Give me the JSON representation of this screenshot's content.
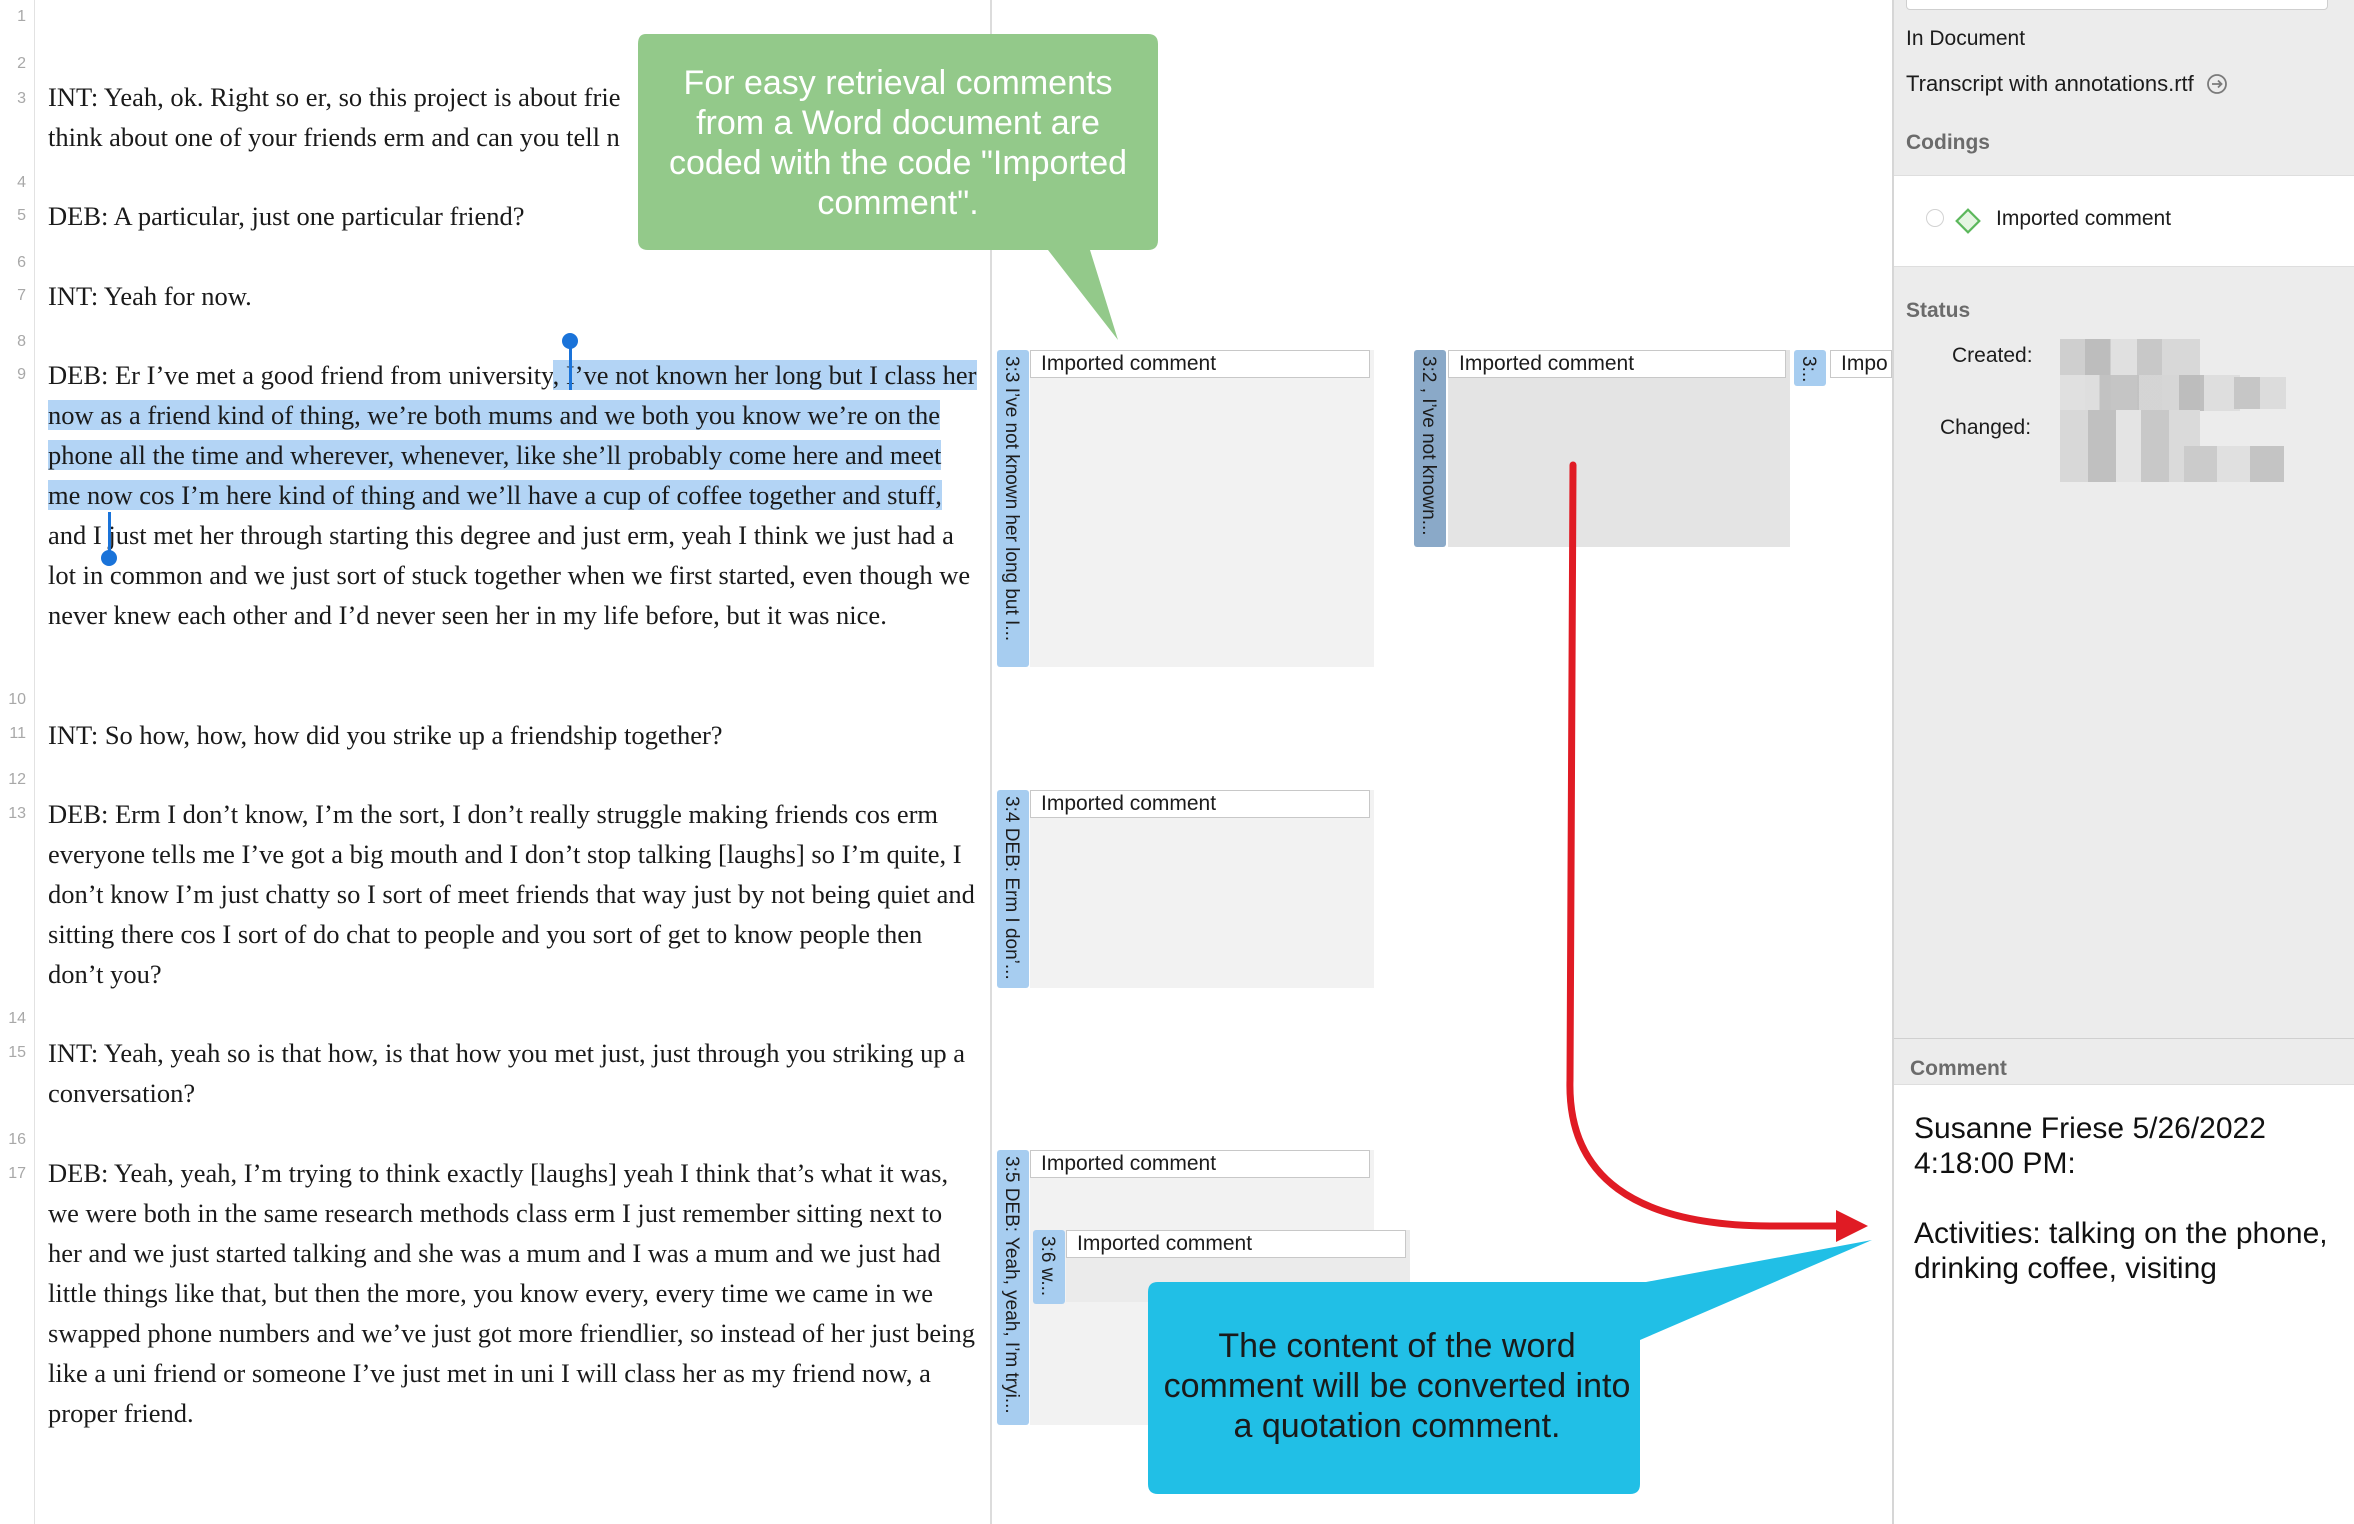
{
  "line_numbers": [
    "1",
    "2",
    "3",
    "4",
    "5",
    "6",
    "7",
    "8",
    "9",
    "10",
    "11",
    "12",
    "13",
    "14",
    "15",
    "16",
    "17"
  ],
  "document": {
    "p3": "INT: Yeah, ok. Right so er, so this project is about frie",
    "p3b": "think about one of your friends erm and can you tell n",
    "p5": "DEB: A particular, just one particular friend?",
    "p7": "INT: Yeah for now.",
    "p9_pre": "DEB: Er I’ve met a good friend from university",
    "p9_sel": ", I’ve not known her long but I class her now as a friend kind of thing, we’re both mums and we both you know we’re on the phone all the time and wherever, whenever, like she’ll probably come here and meet me now cos I’m here kind of thing and we’ll have a cup of coffee together and stuff,",
    "p9_post": " and I just met her through starting this degree and just erm, yeah I think we just had a lot in common and we just sort of stuck together when we first started, even though we never knew each other and I’d never seen her in my life before, but it was nice.",
    "p11": "INT: So how, how, how did you strike up a friendship together?",
    "p13": "DEB: Erm I don’t know, I’m the sort, I don’t really struggle making friends cos erm everyone tells me I’ve got a big mouth and I don’t stop talking [laughs] so I’m quite, I don’t know I’m just chatty so I sort of meet friends that way just by not being quiet and sitting there cos I sort of do chat to people and you sort of get to know people then don’t you?",
    "p15": "INT: Yeah, yeah so is that how, is that how you met just, just through you striking up a conversation?",
    "p17": "DEB: Yeah, yeah, I’m trying to think exactly [laughs] yeah I think that’s what it was, we were both in the same research methods class erm I just remember sitting next to her and we just started talking and she was a mum and I was a mum and we just had little things like that, but then the more, you know every, every time we came in we swapped phone numbers and we’ve just got more friendlier, so instead of her just being like a uni friend or someone I’ve just met in uni I will class her as my friend now, a proper friend."
  },
  "quotations": [
    {
      "id": "3:3 I’ve not known her long but I...",
      "tag": "Imported comment"
    },
    {
      "id": "3:2 , I’ve not known...",
      "tag": "Imported comment"
    },
    {
      "id": "3:...",
      "tag": "Impo"
    },
    {
      "id": "3:4 DEB: Erm I don’...",
      "tag": "Imported comment"
    },
    {
      "id": "3:5 DEB: Yeah, yeah, I’m tryi...",
      "tag": "Imported comment"
    },
    {
      "id": "3:6 w...",
      "tag": "Imported comment"
    }
  ],
  "inspector": {
    "in_document_label": "In Document",
    "document_name": "Transcript with annotations.rtf",
    "codings_title": "Codings",
    "code_name": "Imported comment",
    "status_title": "Status",
    "created_label": "Created:",
    "changed_label": "Changed:",
    "comment_title": "Comment",
    "comment_line1": "Susanne Friese 5/26/2022",
    "comment_line2": "4:18:00 PM:",
    "comment_line3": "Activities: talking on the phone,",
    "comment_line4": "drinking coffee, visiting"
  },
  "callouts": {
    "green": "For easy retrieval comments from a Word document are coded with the code \"Imported comment\".",
    "blue": "The content of the word comment will be converted into a quotation comment."
  },
  "colors": {
    "selection": "#b3d4f5",
    "quotation_bar": "#a7cdf0",
    "green_callout": "#93c98a",
    "blue_callout": "#21bfe6",
    "arrow": "#e01b24",
    "code_icon": "#5cb85c"
  }
}
